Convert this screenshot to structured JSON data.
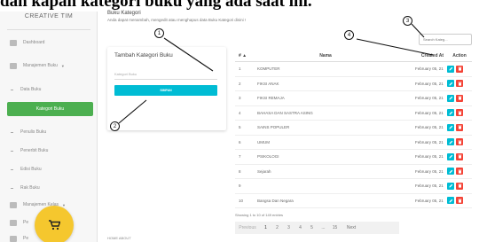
{
  "caption": "dan kapan kategori buku yang ada saat ini.",
  "sidebar": {
    "brand": "CREATIVE TIM",
    "items": [
      {
        "label": "Dashboard"
      },
      {
        "label": "Manajemen Buku"
      },
      {
        "label": "Data Buku"
      },
      {
        "label": "Kategori Buku"
      },
      {
        "label": "Penulis Buku"
      },
      {
        "label": "Penerbit Buku"
      },
      {
        "label": "Edisi Buku"
      },
      {
        "label": "Rak Buku"
      },
      {
        "label": "Manajemen Kelas"
      },
      {
        "label": "Pe"
      },
      {
        "label": "Pe"
      }
    ]
  },
  "page": {
    "title": "Buku Kategori",
    "description": "Anda dapat menambah, mengedit atau menghapus data Buku Kategori disini !"
  },
  "search": {
    "placeholder": "Search Kateg..."
  },
  "form": {
    "title": "Tambah Kategori Buku",
    "input_placeholder": "Kategori Buku",
    "submit_label": "SIMPAN"
  },
  "table": {
    "headers": {
      "no": "# ▲",
      "nama": "Nama",
      "date": "Created At",
      "action": "Action"
    },
    "rows": [
      {
        "no": "1",
        "nama": "KOMPUTER",
        "date": "February 05, 21"
      },
      {
        "no": "2",
        "nama": "FIKSI ANAK",
        "date": "February 05, 21"
      },
      {
        "no": "3",
        "nama": "FIKSI REMAJA",
        "date": "February 05, 21"
      },
      {
        "no": "4",
        "nama": "BAHASA DAN SASTRA ASING",
        "date": "February 05, 21"
      },
      {
        "no": "5",
        "nama": "SAINS POPULER",
        "date": "February 05, 21"
      },
      {
        "no": "6",
        "nama": "UMUM",
        "date": "February 05, 21"
      },
      {
        "no": "7",
        "nama": "PSIKOLOGI",
        "date": "February 05, 21"
      },
      {
        "no": "8",
        "nama": "Sejarah",
        "date": "February 05, 21"
      },
      {
        "no": "9",
        "nama": "",
        "date": "February 05, 21"
      },
      {
        "no": "10",
        "nama": "Bangsa Dan Negara",
        "date": "February 05, 21"
      }
    ],
    "entries_info": "Showing 1 to 10 of 149 entries"
  },
  "pagination": {
    "prev": "Previous",
    "pages": [
      "1",
      "2",
      "3",
      "4",
      "5",
      "...",
      "15"
    ],
    "next": "Next"
  },
  "callouts": [
    "1",
    "2",
    "3",
    "4"
  ],
  "footer": {
    "links": "HOME  ABOUT"
  },
  "colors": {
    "accent_green": "#4caf50",
    "accent_cyan": "#00bcd4",
    "danger_red": "#f44336",
    "fab_yellow": "#f5c72e"
  }
}
